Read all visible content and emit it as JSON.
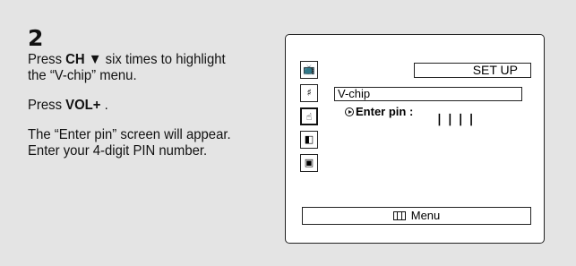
{
  "instructions": {
    "step_number": "2",
    "paragraph1": {
      "before": "Press ",
      "key": "CH ▼",
      "after": " six times to highlight the “V-chip” menu."
    },
    "paragraph2": {
      "before": "Press ",
      "key": "VOL+",
      "after": " ."
    },
    "paragraph3": "The “Enter pin” screen will appear. Enter your 4-digit PIN number."
  },
  "osd": {
    "title": "SET UP",
    "menu_item": "V-chip",
    "pin_label": "Enter pin :",
    "pin_placeholder": "❘❘❘❘",
    "footer_label": "Menu",
    "side_icons": [
      {
        "name": "picture-icon",
        "glyph": "📺"
      },
      {
        "name": "sound-icon",
        "glyph": "♯"
      },
      {
        "name": "setup-hand-icon",
        "glyph": "☝"
      },
      {
        "name": "input-icon",
        "glyph": "◧"
      },
      {
        "name": "tv-timer-icon",
        "glyph": "▣"
      }
    ],
    "selected_icon_index": 2
  }
}
